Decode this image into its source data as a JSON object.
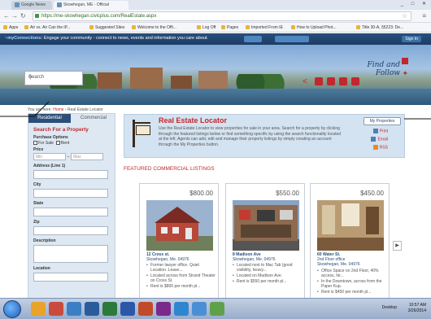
{
  "browser": {
    "tabs": [
      {
        "label": "Google News"
      },
      {
        "label": "Skowhegan, ME - Official"
      }
    ],
    "url": "https://me-skowhegan.civicplus.com/RealEstate.aspx",
    "bookmarks": [
      {
        "label": "Apps"
      },
      {
        "label": "Air vs. Air Can the iP..."
      },
      {
        "label": "Suggested Sites"
      },
      {
        "label": "Welcome to the Offi..."
      },
      {
        "label": "Log Off"
      },
      {
        "label": "Pages"
      },
      {
        "label": "Imported From IE"
      },
      {
        "label": "How to Upload Phot..."
      },
      {
        "label": "Title 30-A, §5223: De..."
      }
    ]
  },
  "site": {
    "connections_label": "~myConnections:",
    "connections_text": "Engage your community - connect to news, events and information you care about.",
    "signin_label": "Sign In",
    "search_placeholder": "Search",
    "slogan_line1": "Find and",
    "slogan_line2": "Follow",
    "breadcrumb": {
      "prefix": "You are here:",
      "home": "Home",
      "sep": "›",
      "current": "Real Estate Locator"
    }
  },
  "left_panel": {
    "tab_residential": "Residential",
    "tab_commercial": "Commercial",
    "heading": "Search For a Property",
    "purchase_options": "Purchase Options",
    "for_sale": "For Sale",
    "rent": "Rent",
    "price": "Price",
    "min_placeholder": "Min",
    "max_placeholder": "Max",
    "fields": [
      "Address (Line 1)",
      "City",
      "State",
      "Zip",
      "Description",
      "Location"
    ]
  },
  "locator": {
    "title": "Real Estate Locator",
    "description": "Use the Real Estate Locator to view properties for sale in your area. Search for a property by clicking through the featured listings below or find something specific by using the search functionality located at the left. Agents can add, edit and manage their property listings by simply creating an account through the My Properties button.",
    "my_properties": "My Properties",
    "actions": [
      "Print",
      "Email",
      "RSS"
    ]
  },
  "featured_title": "FEATURED COMMERCIAL LISTINGS",
  "listings": [
    {
      "price": "$800.00",
      "street": "12 Cross st.",
      "city": "Skowhegan, Me. 04976",
      "bullets": [
        "Former lawyer office. Quiet Location. Lease...",
        "Located across from Strand Theater on Cross St.",
        "Rent is $800 per month pl..."
      ]
    },
    {
      "price": "$550.00",
      "street": "8 Madison Ave",
      "city": "Skowhegan, Me. 04976",
      "bullets": [
        "Located next to Mac Tab (good visibility, heavy...",
        "Located on Madison Ave.",
        "Rent is $550 per month pl..."
      ]
    },
    {
      "price": "$450.00",
      "street": "60 Water St.",
      "city": "2nd Floor office",
      "city2": "Skowhegan, Me. 04976",
      "bullets": [
        "Office Space on 2nd Floor, 40% access, hir...",
        "In the Downtown, across from the Paper Kup.",
        "Rent is $450 per month pl..."
      ]
    }
  ],
  "taskbar": {
    "desktop_label": "Desktop",
    "time": "10:57 AM",
    "date": "3/26/2014"
  }
}
